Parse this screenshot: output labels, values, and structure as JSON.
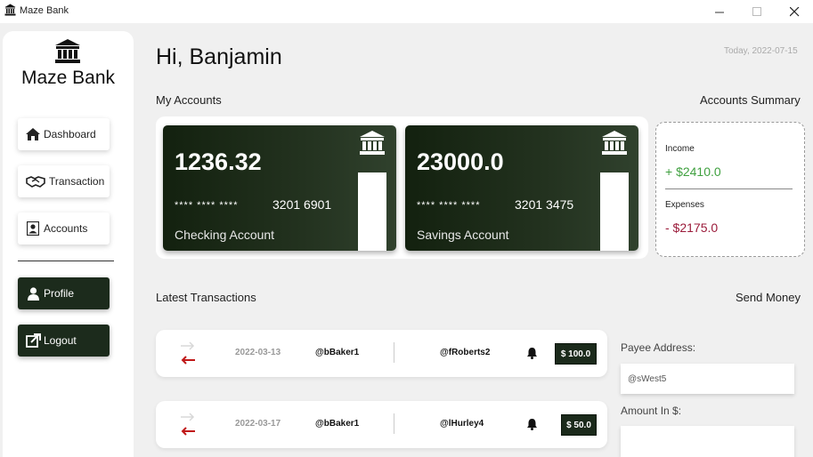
{
  "window": {
    "title": "Maze Bank"
  },
  "sidebar": {
    "logo_text": "Maze Bank",
    "items": [
      {
        "label": "Dashboard",
        "icon": "home-icon"
      },
      {
        "label": "Transaction",
        "icon": "handshake-icon"
      },
      {
        "label": "Accounts",
        "icon": "account-box-icon"
      },
      {
        "label": "Profile",
        "icon": "user-icon"
      },
      {
        "label": "Logout",
        "icon": "external-link-icon"
      }
    ]
  },
  "header": {
    "greeting": "Hi, Banjamin",
    "date": "Today, 2022-07-15"
  },
  "accounts": {
    "title": "My Accounts",
    "summary_title": "Accounts Summary",
    "cards": [
      {
        "balance": "1236.32",
        "mask": "**** **** ****",
        "number": "3201 6901",
        "type": "Checking Account"
      },
      {
        "balance": "23000.0",
        "mask": "**** **** ****",
        "number": "3201 3475",
        "type": "Savings Account"
      }
    ]
  },
  "summary": {
    "income_label": "Income",
    "income_value": "+ $2410.0",
    "expenses_label": "Expenses",
    "expenses_value": "- $2175.0",
    "income_color": "#3fa03f",
    "expenses_color": "#9b1b3a"
  },
  "transactions": {
    "title": "Latest Transactions",
    "rows": [
      {
        "date": "2022-03-13",
        "sender": "@bBaker1",
        "receiver": "@fRoberts2",
        "amount": "$ 100.0"
      },
      {
        "date": "2022-03-17",
        "sender": "@bBaker1",
        "receiver": "@lHurley4",
        "amount": "$ 50.0"
      }
    ]
  },
  "send_money": {
    "title": "Send Money",
    "payee_label": "Payee Address:",
    "payee_value": "@sWest5",
    "amount_label": "Amount In $:",
    "amount_value": ""
  }
}
